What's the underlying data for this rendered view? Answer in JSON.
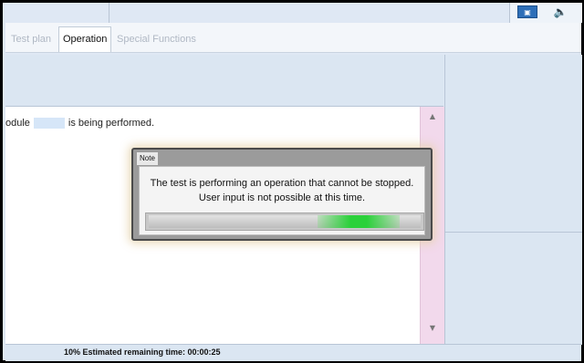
{
  "tabs": [
    {
      "label": "Test plan",
      "active": false
    },
    {
      "label": "Operation",
      "active": true
    },
    {
      "label": "Special Functions",
      "active": false
    }
  ],
  "toolbar": {
    "icons": [
      "monitor-icon",
      "speaker-icon"
    ]
  },
  "content": {
    "message_prefix": "odule",
    "message_suffix": "is being performed."
  },
  "dialog": {
    "title": "Note",
    "line1": "The test is performing an operation that cannot be stopped.",
    "line2": "User input is not possible at this time.",
    "progress_fraction": 0.1
  },
  "status": {
    "text": "10% Estimated remaining time: 00:00:25"
  },
  "colors": {
    "accent_green": "#2bd13a",
    "panel_bg": "#dbe6f2",
    "scrollbar_bg": "#f2d9ec"
  }
}
